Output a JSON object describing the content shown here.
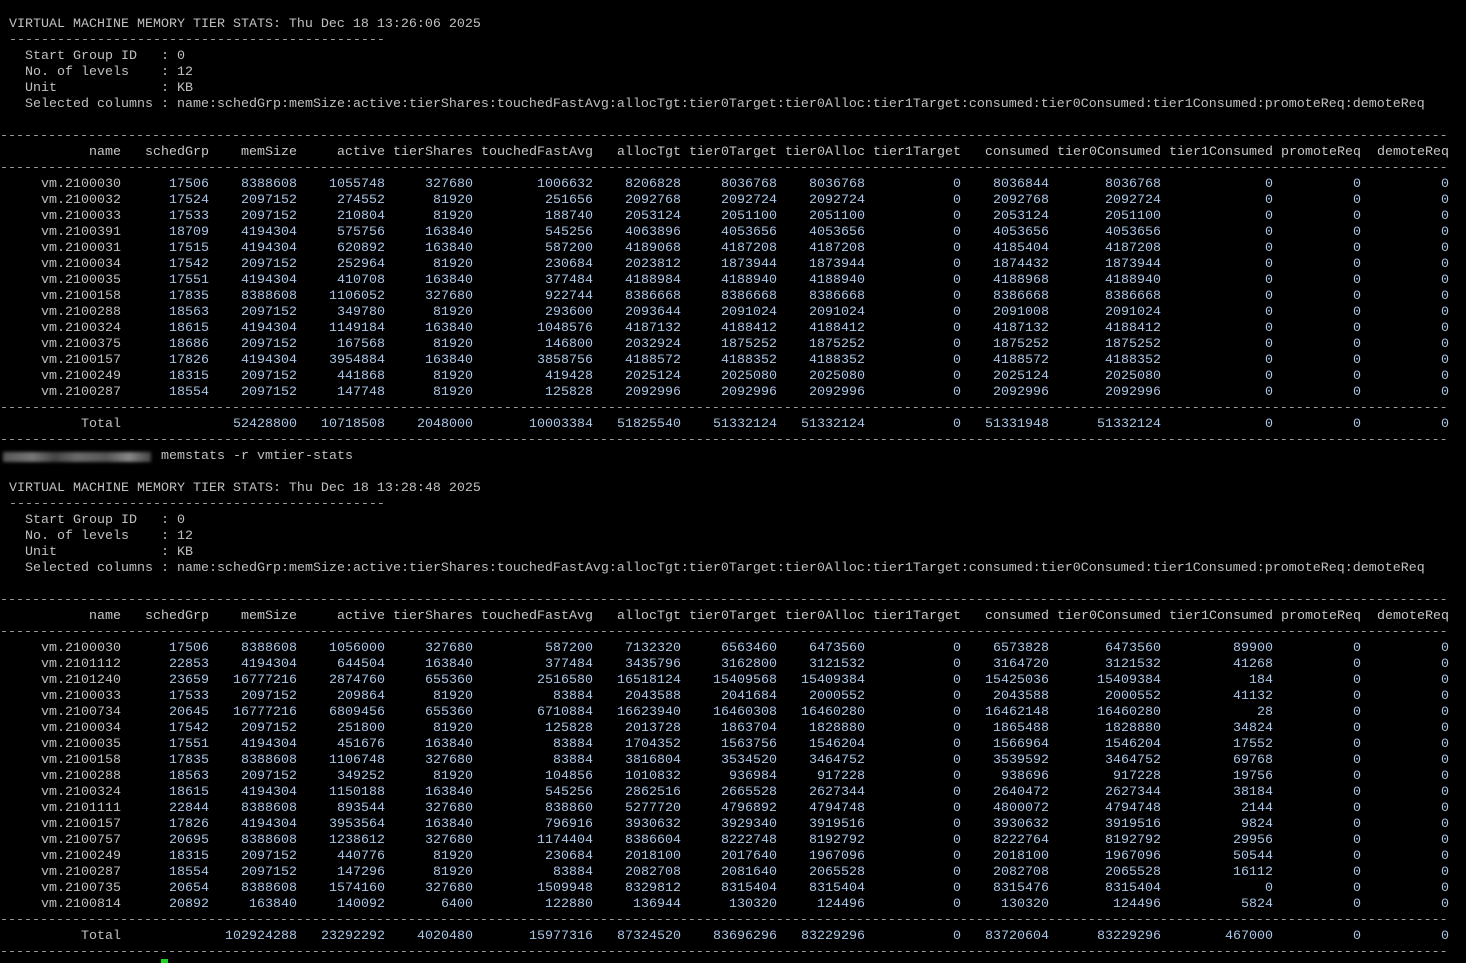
{
  "snapshots": [
    {
      "title": "VIRTUAL MACHINE MEMORY TIER STATS: Thu Dec 18 13:26:06 2025",
      "info": [
        {
          "label": "Start Group ID   ",
          "value": ": 0"
        },
        {
          "label": "No. of levels    ",
          "value": ": 12"
        },
        {
          "label": "Unit             ",
          "value": ": KB"
        },
        {
          "label": "Selected columns ",
          "value": ": name:schedGrp:memSize:active:tierShares:touchedFastAvg:allocTgt:tier0Target:tier0Alloc:tier1Target:consumed:tier0Consumed:tier1Consumed:promoteReq:demoteReq"
        }
      ],
      "rows": [
        [
          "vm.2100030",
          "17506",
          "8388608",
          "1055748",
          "327680",
          "1006632",
          "8206828",
          "8036768",
          "8036768",
          "0",
          "8036844",
          "8036768",
          "0",
          "0",
          "0"
        ],
        [
          "vm.2100032",
          "17524",
          "2097152",
          "274552",
          "81920",
          "251656",
          "2092768",
          "2092724",
          "2092724",
          "0",
          "2092768",
          "2092724",
          "0",
          "0",
          "0"
        ],
        [
          "vm.2100033",
          "17533",
          "2097152",
          "210804",
          "81920",
          "188740",
          "2053124",
          "2051100",
          "2051100",
          "0",
          "2053124",
          "2051100",
          "0",
          "0",
          "0"
        ],
        [
          "vm.2100391",
          "18709",
          "4194304",
          "575756",
          "163840",
          "545256",
          "4063896",
          "4053656",
          "4053656",
          "0",
          "4053656",
          "4053656",
          "0",
          "0",
          "0"
        ],
        [
          "vm.2100031",
          "17515",
          "4194304",
          "620892",
          "163840",
          "587200",
          "4189068",
          "4187208",
          "4187208",
          "0",
          "4185404",
          "4187208",
          "0",
          "0",
          "0"
        ],
        [
          "vm.2100034",
          "17542",
          "2097152",
          "252964",
          "81920",
          "230684",
          "2023812",
          "1873944",
          "1873944",
          "0",
          "1874432",
          "1873944",
          "0",
          "0",
          "0"
        ],
        [
          "vm.2100035",
          "17551",
          "4194304",
          "410708",
          "163840",
          "377484",
          "4188984",
          "4188940",
          "4188940",
          "0",
          "4188968",
          "4188940",
          "0",
          "0",
          "0"
        ],
        [
          "vm.2100158",
          "17835",
          "8388608",
          "1106052",
          "327680",
          "922744",
          "8386668",
          "8386668",
          "8386668",
          "0",
          "8386668",
          "8386668",
          "0",
          "0",
          "0"
        ],
        [
          "vm.2100288",
          "18563",
          "2097152",
          "349780",
          "81920",
          "293600",
          "2093644",
          "2091024",
          "2091024",
          "0",
          "2091008",
          "2091024",
          "0",
          "0",
          "0"
        ],
        [
          "vm.2100324",
          "18615",
          "4194304",
          "1149184",
          "163840",
          "1048576",
          "4187132",
          "4188412",
          "4188412",
          "0",
          "4187132",
          "4188412",
          "0",
          "0",
          "0"
        ],
        [
          "vm.2100375",
          "18686",
          "2097152",
          "167568",
          "81920",
          "146800",
          "2032924",
          "1875252",
          "1875252",
          "0",
          "1875252",
          "1875252",
          "0",
          "0",
          "0"
        ],
        [
          "vm.2100157",
          "17826",
          "4194304",
          "3954884",
          "163840",
          "3858756",
          "4188572",
          "4188352",
          "4188352",
          "0",
          "4188572",
          "4188352",
          "0",
          "0",
          "0"
        ],
        [
          "vm.2100249",
          "18315",
          "2097152",
          "441868",
          "81920",
          "419428",
          "2025124",
          "2025080",
          "2025080",
          "0",
          "2025124",
          "2025080",
          "0",
          "0",
          "0"
        ],
        [
          "vm.2100287",
          "18554",
          "2097152",
          "147748",
          "81920",
          "125828",
          "2092996",
          "2092996",
          "2092996",
          "0",
          "2092996",
          "2092996",
          "0",
          "0",
          "0"
        ]
      ],
      "total": [
        "Total",
        "",
        "52428800",
        "10718508",
        "2048000",
        "10003384",
        "51825540",
        "51332124",
        "51332124",
        "0",
        "51331948",
        "51332124",
        "0",
        "0",
        "0"
      ]
    },
    {
      "title": "VIRTUAL MACHINE MEMORY TIER STATS: Thu Dec 18 13:28:48 2025",
      "info": [
        {
          "label": "Start Group ID   ",
          "value": ": 0"
        },
        {
          "label": "No. of levels    ",
          "value": ": 12"
        },
        {
          "label": "Unit             ",
          "value": ": KB"
        },
        {
          "label": "Selected columns ",
          "value": ": name:schedGrp:memSize:active:tierShares:touchedFastAvg:allocTgt:tier0Target:tier0Alloc:tier1Target:consumed:tier0Consumed:tier1Consumed:promoteReq:demoteReq"
        }
      ],
      "rows": [
        [
          "vm.2100030",
          "17506",
          "8388608",
          "1056000",
          "327680",
          "587200",
          "7132320",
          "6563460",
          "6473560",
          "0",
          "6573828",
          "6473560",
          "89900",
          "0",
          "0"
        ],
        [
          "vm.2101112",
          "22853",
          "4194304",
          "644504",
          "163840",
          "377484",
          "3435796",
          "3162800",
          "3121532",
          "0",
          "3164720",
          "3121532",
          "41268",
          "0",
          "0"
        ],
        [
          "vm.2101240",
          "23659",
          "16777216",
          "2874760",
          "655360",
          "2516580",
          "16518124",
          "15409568",
          "15409384",
          "0",
          "15425036",
          "15409384",
          "184",
          "0",
          "0"
        ],
        [
          "vm.2100033",
          "17533",
          "2097152",
          "209864",
          "81920",
          "83884",
          "2043588",
          "2041684",
          "2000552",
          "0",
          "2043588",
          "2000552",
          "41132",
          "0",
          "0"
        ],
        [
          "vm.2100734",
          "20645",
          "16777216",
          "6809456",
          "655360",
          "6710884",
          "16623940",
          "16460308",
          "16460280",
          "0",
          "16462148",
          "16460280",
          "28",
          "0",
          "0"
        ],
        [
          "vm.2100034",
          "17542",
          "2097152",
          "251800",
          "81920",
          "125828",
          "2013728",
          "1863704",
          "1828880",
          "0",
          "1865488",
          "1828880",
          "34824",
          "0",
          "0"
        ],
        [
          "vm.2100035",
          "17551",
          "4194304",
          "451676",
          "163840",
          "83884",
          "1704352",
          "1563756",
          "1546204",
          "0",
          "1566964",
          "1546204",
          "17552",
          "0",
          "0"
        ],
        [
          "vm.2100158",
          "17835",
          "8388608",
          "1106748",
          "327680",
          "83884",
          "3816804",
          "3534520",
          "3464752",
          "0",
          "3539592",
          "3464752",
          "69768",
          "0",
          "0"
        ],
        [
          "vm.2100288",
          "18563",
          "2097152",
          "349252",
          "81920",
          "104856",
          "1010832",
          "936984",
          "917228",
          "0",
          "938696",
          "917228",
          "19756",
          "0",
          "0"
        ],
        [
          "vm.2100324",
          "18615",
          "4194304",
          "1150188",
          "163840",
          "545256",
          "2862516",
          "2665528",
          "2627344",
          "0",
          "2640472",
          "2627344",
          "38184",
          "0",
          "0"
        ],
        [
          "vm.2101111",
          "22844",
          "8388608",
          "893544",
          "327680",
          "838860",
          "5277720",
          "4796892",
          "4794748",
          "0",
          "4800072",
          "4794748",
          "2144",
          "0",
          "0"
        ],
        [
          "vm.2100157",
          "17826",
          "4194304",
          "3953564",
          "163840",
          "796916",
          "3930632",
          "3929340",
          "3919516",
          "0",
          "3930632",
          "3919516",
          "9824",
          "0",
          "0"
        ],
        [
          "vm.2100757",
          "20695",
          "8388608",
          "1238612",
          "327680",
          "1174404",
          "8386604",
          "8222748",
          "8192792",
          "0",
          "8222764",
          "8192792",
          "29956",
          "0",
          "0"
        ],
        [
          "vm.2100249",
          "18315",
          "2097152",
          "440776",
          "81920",
          "230684",
          "2018100",
          "2017640",
          "1967096",
          "0",
          "2018100",
          "1967096",
          "50544",
          "0",
          "0"
        ],
        [
          "vm.2100287",
          "18554",
          "2097152",
          "147296",
          "81920",
          "83884",
          "2082708",
          "2081640",
          "2065528",
          "0",
          "2082708",
          "2065528",
          "16112",
          "0",
          "0"
        ],
        [
          "vm.2100735",
          "20654",
          "8388608",
          "1574160",
          "327680",
          "1509948",
          "8329812",
          "8315404",
          "8315404",
          "0",
          "8315476",
          "8315404",
          "0",
          "0",
          "0"
        ],
        [
          "vm.2100814",
          "20892",
          "163840",
          "140092",
          "6400",
          "122880",
          "136944",
          "130320",
          "124496",
          "0",
          "130320",
          "124496",
          "5824",
          "0",
          "0"
        ]
      ],
      "total": [
        "Total",
        "",
        "102924288",
        "23292292",
        "4020480",
        "15977316",
        "87324520",
        "83696296",
        "83229296",
        "0",
        "83720604",
        "83229296",
        "467000",
        "0",
        "0"
      ]
    }
  ],
  "columns": [
    "name",
    "schedGrp",
    "memSize",
    "active",
    "tierShares",
    "touchedFastAvg",
    "allocTgt",
    "tier0Target",
    "tier0Alloc",
    "tier1Target",
    "consumed",
    "tier0Consumed",
    "tier1Consumed",
    "promoteReq",
    "demoteReq"
  ],
  "command": "memstats -r vmtier-stats"
}
